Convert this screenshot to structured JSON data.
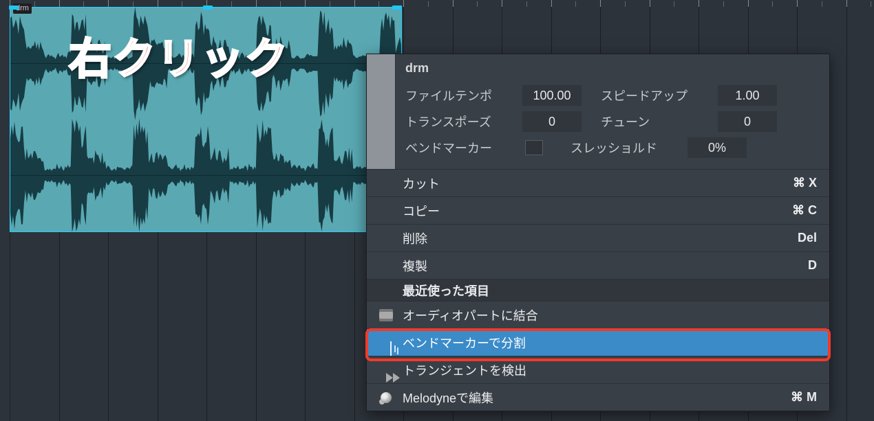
{
  "clip": {
    "name": "drm"
  },
  "annotation": {
    "text": "右クリック"
  },
  "info": {
    "title": "drm",
    "fileTempoLabel": "ファイルテンポ",
    "fileTempoValue": "100.00",
    "speedUpLabel": "スピードアップ",
    "speedUpValue": "1.00",
    "transposeLabel": "トランスポーズ",
    "transposeValue": "0",
    "tuneLabel": "チューン",
    "tuneValue": "0",
    "bendMarkerLabel": "ベンドマーカー",
    "thresholdLabel": "スレッショルド",
    "thresholdValue": "0%"
  },
  "items": {
    "cut": {
      "label": "カット",
      "shortcut": "⌘ X"
    },
    "copy": {
      "label": "コピー",
      "shortcut": "⌘ C"
    },
    "delete": {
      "label": "削除",
      "shortcut": "Del"
    },
    "duplicate": {
      "label": "複製",
      "shortcut": "D"
    },
    "recent": {
      "label": "最近使った項目"
    },
    "mergeAudio": {
      "label": "オーディオパートに結合"
    },
    "splitBend": {
      "label": "ベンドマーカーで分割"
    },
    "detectTrans": {
      "label": "トランジェントを検出"
    },
    "melodyne": {
      "label": "Melodyneで編集",
      "shortcut": "⌘ M"
    }
  }
}
